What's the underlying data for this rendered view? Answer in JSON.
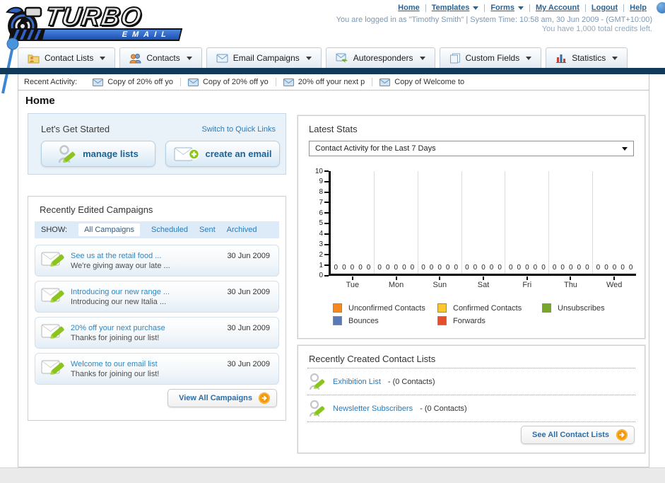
{
  "header": {
    "logo": {
      "title": "TURBO",
      "subtitle": "EMAIL"
    },
    "nav_links": [
      {
        "label": "Home",
        "dropdown": false
      },
      {
        "label": "Templates",
        "dropdown": true
      },
      {
        "label": "Forms",
        "dropdown": true
      },
      {
        "label": "My Account",
        "dropdown": false
      },
      {
        "label": "Logout",
        "dropdown": false
      },
      {
        "label": "Help",
        "dropdown": false
      }
    ],
    "login_info": "You are logged in as \"Timothy Smith\" | System Time: 10:58 am, 30 Jun 2009 - (GMT+10:00)",
    "credits_info": "You have 1,000 total credits left."
  },
  "nav_tabs": [
    {
      "label": "Contact Lists",
      "icon": "contact-lists-icon"
    },
    {
      "label": "Contacts",
      "icon": "contacts-icon"
    },
    {
      "label": "Email Campaigns",
      "icon": "email-campaigns-icon"
    },
    {
      "label": "Autoresponders",
      "icon": "autoresponders-icon"
    },
    {
      "label": "Custom Fields",
      "icon": "custom-fields-icon"
    },
    {
      "label": "Statistics",
      "icon": "statistics-icon"
    }
  ],
  "recent_activity": {
    "label": "Recent Activity:",
    "items": [
      "Copy of 20% off yo",
      "Copy of 20% off yo",
      "20% off your next p",
      "Copy of Welcome to"
    ]
  },
  "page_title": "Home",
  "get_started": {
    "title": "Let's Get Started",
    "switch_link": "Switch to Quick Links",
    "manage_lists_button": "manage lists",
    "create_email_button": "create an email"
  },
  "campaigns": {
    "title": "Recently Edited Campaigns",
    "show_label": "SHOW:",
    "active_filter": "All Campaigns",
    "filters": [
      "Scheduled",
      "Sent",
      "Archived"
    ],
    "items": [
      {
        "title": "See us at the retail food ...",
        "subtitle": "We're giving away our late ...",
        "date": "30 Jun 2009"
      },
      {
        "title": "Introducing our new range ...",
        "subtitle": "Introducing our new Italia ...",
        "date": "30 Jun 2009"
      },
      {
        "title": "20% off your next purchase",
        "subtitle": "Thanks for joining our list!",
        "date": "30 Jun 2009"
      },
      {
        "title": "Welcome to our email list",
        "subtitle": "Thanks for joining our list!",
        "date": "30 Jun 2009"
      }
    ],
    "view_all_button": "View All Campaigns"
  },
  "latest_stats": {
    "title": "Latest Stats",
    "dropdown_value": "Contact Activity for the Last 7 Days"
  },
  "chart_data": {
    "type": "bar",
    "title": "Contact Activity for the Last 7 Days",
    "categories": [
      "Tue",
      "Mon",
      "Sun",
      "Sat",
      "Fri",
      "Thu",
      "Wed"
    ],
    "series": [
      {
        "name": "Unconfirmed Contacts",
        "color": "#f5881f",
        "values": [
          0,
          0,
          0,
          0,
          0,
          0,
          0
        ]
      },
      {
        "name": "Confirmed Contacts",
        "color": "#fdc62a",
        "values": [
          0,
          0,
          0,
          0,
          0,
          0,
          0
        ]
      },
      {
        "name": "Unsubscribes",
        "color": "#77a62a",
        "values": [
          0,
          0,
          0,
          0,
          0,
          0,
          0
        ]
      },
      {
        "name": "Bounces",
        "color": "#5b79b5",
        "values": [
          0,
          0,
          0,
          0,
          0,
          0,
          0
        ]
      },
      {
        "name": "Forwards",
        "color": "#e64f2d",
        "values": [
          0,
          0,
          0,
          0,
          0,
          0,
          0
        ]
      }
    ],
    "xlabel": "",
    "ylabel": "",
    "ylim": [
      0,
      10
    ],
    "ytick_step": 1,
    "grid": true,
    "legend_position": "bottom"
  },
  "contact_lists": {
    "title": "Recently Created Contact Lists",
    "items": [
      {
        "name": "Exhibition List",
        "detail": "- (0 Contacts)"
      },
      {
        "name": "Newsletter Subscribers",
        "detail": "- (0 Contacts)"
      }
    ],
    "see_all_button": "See All Contact Lists"
  },
  "colors": {
    "navy_bar": "#11395a",
    "link_blue": "#2a7ab8",
    "top_link_blue": "#2a6496",
    "button_text_blue": "#1b6397",
    "orange_arrow": "#f2990f"
  }
}
